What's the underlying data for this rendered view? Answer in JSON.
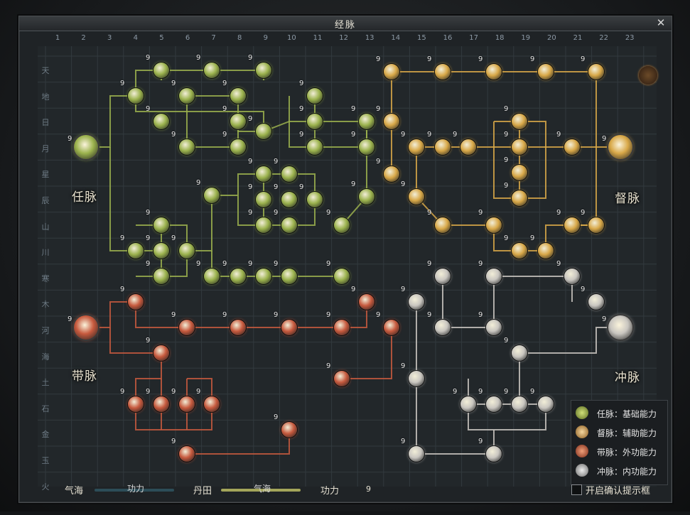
{
  "window": {
    "title": "经脉",
    "close_glyph": "✕"
  },
  "columns": [
    "1",
    "2",
    "3",
    "4",
    "5",
    "6",
    "7",
    "8",
    "9",
    "10",
    "11",
    "12",
    "13",
    "14",
    "15",
    "16",
    "17",
    "18",
    "19",
    "20",
    "21",
    "22",
    "23"
  ],
  "rows": [
    "天",
    "地",
    "日",
    "月",
    "星",
    "辰",
    "山",
    "川",
    "寒",
    "木",
    "河",
    "海",
    "土",
    "石",
    "金",
    "玉",
    "火"
  ],
  "meridians": {
    "ren": {
      "label": "任脉",
      "color": "#9bb24d"
    },
    "du": {
      "label": "督脉",
      "color": "#d8a848"
    },
    "dai": {
      "label": "带脉",
      "color": "#c75a3e"
    },
    "chong": {
      "label": "冲脉",
      "color": "#c9c6c0"
    }
  },
  "node_count": "9",
  "legend": [
    {
      "icon": "ren-icon",
      "text": "任脉：基础能力",
      "color": "#9bb24d"
    },
    {
      "icon": "du-icon",
      "text": "督脉：辅助能力",
      "color": "#d8a848"
    },
    {
      "icon": "dai-icon",
      "text": "带脉：外功能力",
      "color": "#c75a3e"
    },
    {
      "icon": "chong-icon",
      "text": "冲脉：内功能力",
      "color": "#c9c6c0"
    }
  ],
  "bottom": {
    "qihai_label": "气海",
    "qihai_bar_text": "功力",
    "dantian_label": "丹田",
    "dantian_bar_text": "气海",
    "gongli_label": "功力",
    "gongli_value": "9",
    "confirm_label": "开启确认提示框"
  }
}
